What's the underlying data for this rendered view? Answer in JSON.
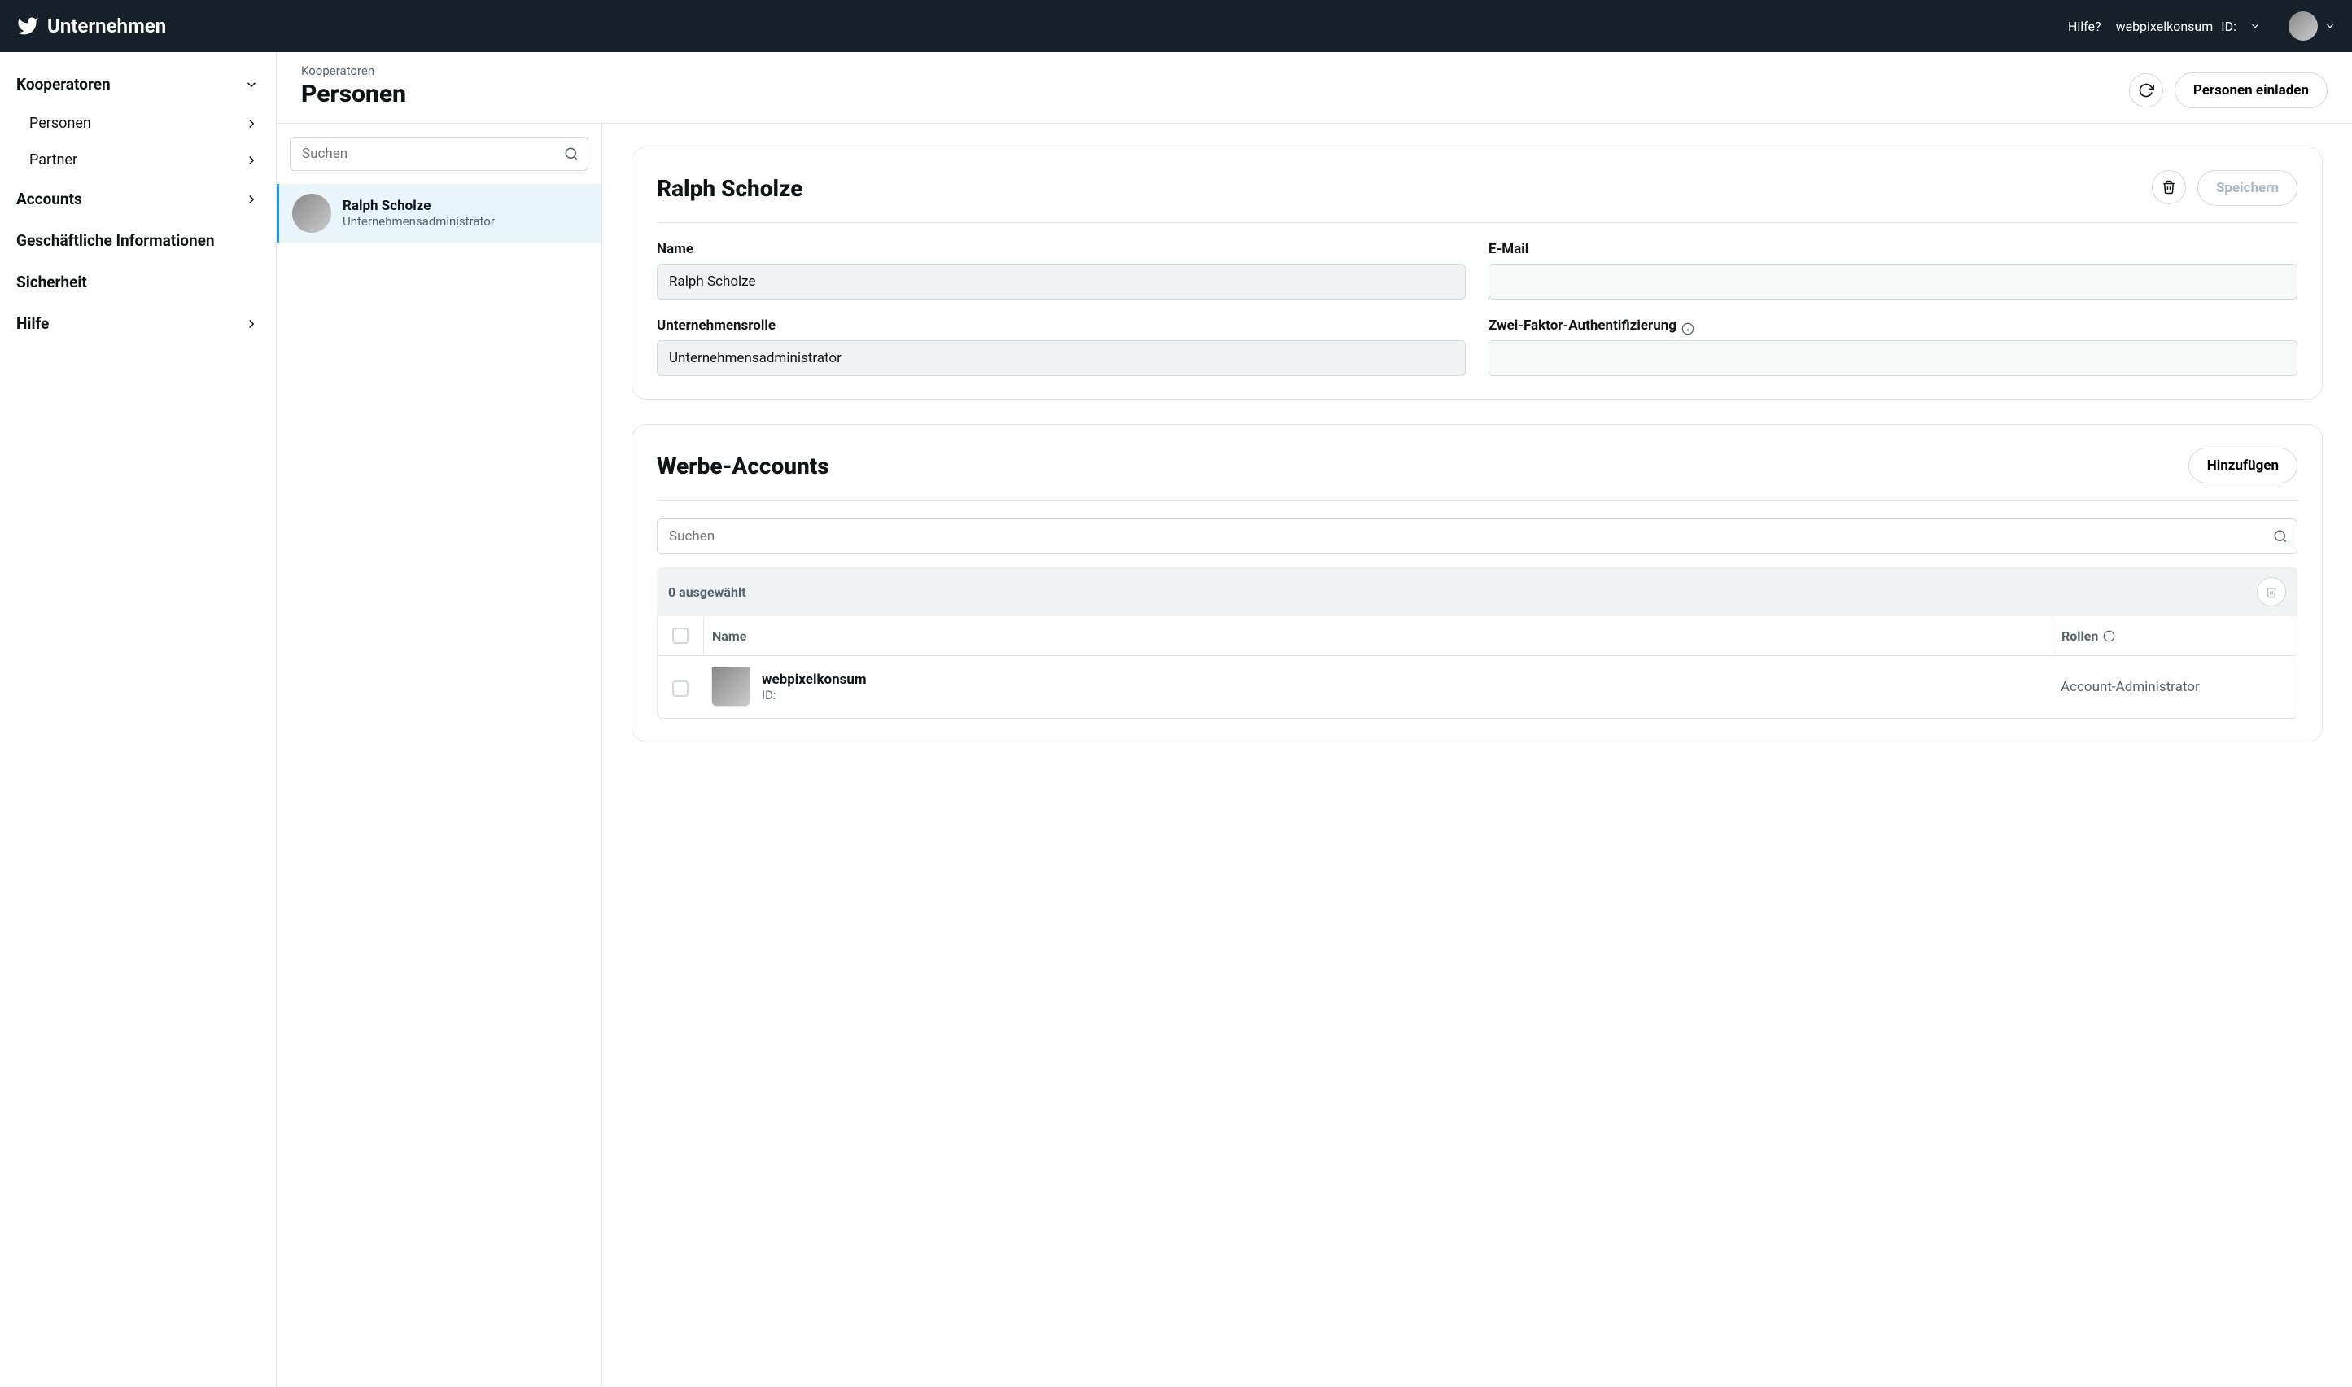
{
  "header": {
    "brand": "Unternehmen",
    "help": "Hilfe?",
    "account_name": "webpixelkonsum",
    "account_id_label": "ID:"
  },
  "sidebar": {
    "items": [
      {
        "label": "Kooperatoren",
        "expandable": true,
        "expanded": true
      },
      {
        "label": "Accounts",
        "expandable": true,
        "expanded": false
      },
      {
        "label": "Geschäftliche Informationen",
        "expandable": false
      },
      {
        "label": "Sicherheit",
        "expandable": false
      },
      {
        "label": "Hilfe",
        "expandable": true,
        "expanded": false
      }
    ],
    "kooperatoren_sub": [
      {
        "label": "Personen"
      },
      {
        "label": "Partner"
      }
    ]
  },
  "page": {
    "breadcrumb": "Kooperatoren",
    "title": "Personen",
    "invite_button": "Personen einladen"
  },
  "list": {
    "search_placeholder": "Suchen",
    "people": [
      {
        "name": "Ralph Scholze",
        "role": "Unternehmensadministrator",
        "selected": true
      }
    ]
  },
  "detail": {
    "title": "Ralph Scholze",
    "save_button": "Speichern",
    "fields": {
      "name_label": "Name",
      "name_value": "Ralph Scholze",
      "email_label": "E-Mail",
      "email_value": "",
      "role_label": "Unternehmensrolle",
      "role_value": "Unternehmensadministrator",
      "twofa_label": "Zwei-Faktor-Authentifizierung",
      "twofa_value": ""
    }
  },
  "ad_accounts": {
    "title": "Werbe-Accounts",
    "add_button": "Hinzufügen",
    "search_placeholder": "Suchen",
    "selected_text": "0 ausgewählt",
    "columns": {
      "name": "Name",
      "roles": "Rollen"
    },
    "rows": [
      {
        "name": "webpixelkonsum",
        "id_label": "ID:",
        "role": "Account-Administrator"
      }
    ]
  }
}
